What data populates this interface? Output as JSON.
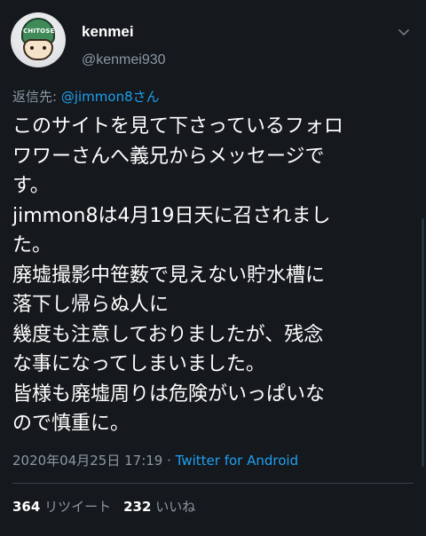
{
  "tweet": {
    "display_name": "kenmei",
    "handle": "@kenmei930",
    "avatar_text": "CHITOSE",
    "reply_prefix": "返信先: ",
    "reply_mention": "@jimmon8さん",
    "lines": [
      "このサイトを見て下さっているフォロ",
      "ワワーさんへ義兄からメッセージで",
      "す。",
      "jimmon8は4月19日天に召されまし",
      "た。",
      "廃墟撮影中笹薮で見えない貯水槽に",
      "落下し帰らぬ人に",
      "幾度も注意しておりましたが、残念",
      "な事になってしまいました。",
      "皆様も廃墟周りは危険がいっぱいな",
      "ので慎重に。"
    ],
    "timestamp": "2020年04月25日 17:19",
    "separator": " · ",
    "source": "Twitter for Android",
    "retweet_count": "364",
    "retweet_label": "リツイート",
    "like_count": "232",
    "like_label": "いいね"
  },
  "colors": {
    "background": "#15181c",
    "text": "#ffffff",
    "secondary": "#8b98a5",
    "link": "#1da1f2",
    "divider": "#38444d"
  },
  "icons": {
    "caret": "chevron-down-icon"
  }
}
